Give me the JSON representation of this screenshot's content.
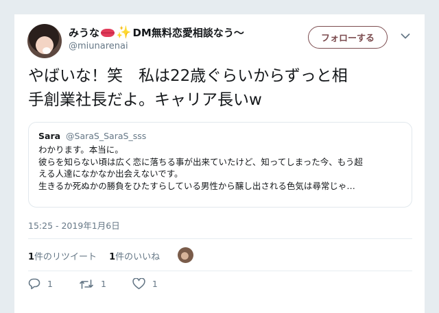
{
  "user": {
    "display_name_prefix": "みうな",
    "display_name_suffix": "DM無料恋愛相談なう〜",
    "handle": "@miunarenai"
  },
  "follow_button": {
    "label": "フォローする"
  },
  "tweet": {
    "line1": "やばいな！笑　私は22歳ぐらいからずっと相",
    "line2": "手創業社長だよ。キャリア長いw"
  },
  "quoted": {
    "name": "Sara",
    "handle": "@SaraS_SaraS_sss",
    "lines": [
      "わかります。本当に。",
      "彼らを知らない頃は広く恋に落ちる事が出来ていたけど、知ってしまった今、もう超",
      "える人達になかなか出会えないです。",
      "生きるか死ぬかの勝負をひたすらしている男性から醸し出される色気は尋常じゃ…"
    ]
  },
  "timestamp": "15:25 - 2019年1月6日",
  "stats": {
    "retweet_count": "1",
    "retweet_label": "件のリツイート",
    "like_count": "1",
    "like_label": "件のいいね"
  },
  "actions": {
    "reply_count": "1",
    "retweet_count": "1",
    "like_count": "1"
  },
  "colors": {
    "follow_accent": "#7b4b4e",
    "secondary_text": "#657786",
    "divider": "#e6ecf0"
  },
  "icons": [
    "chevron-down-icon",
    "reply-icon",
    "retweet-icon",
    "like-icon",
    "lips-emoji",
    "sparkles-emoji"
  ]
}
